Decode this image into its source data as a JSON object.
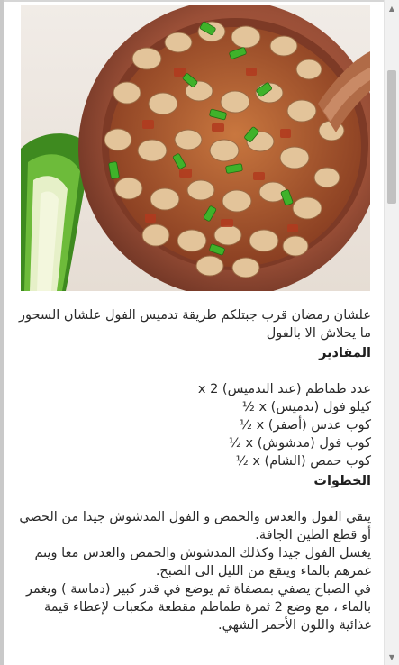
{
  "hero": {
    "icon": "foul-medames-dish-photo"
  },
  "article": {
    "intro": "علشان رمضان قرب جبتلكم طريقة تدميس الفول علشان السحور ما يحلاش الا بالفول",
    "ingredients_heading": "المقادير",
    "ingredients": [
      "عدد طماطم (عند التدميس) x 2",
      "كيلو فول (تدميس) x ½",
      "كوب عدس (أصفر) x ½",
      "كوب فول (مدشوش) x ½",
      "كوب حمص (الشام) x ½"
    ],
    "steps_heading": "الخطوات",
    "steps": [
      "ينقي الفول والعدس والحمص و الفول المدشوش جيدا من الحصي أو قطع الطين الجافة.",
      "يغسل الفول جيدا وكذلك المدشوش والحمص والعدس معا ويتم غمرهم بالماء ويتقع من الليل الى الصبح.",
      "في الصباح يصفي بمصفاة ثم يوضع في قدر كبير (دماسة ) ويغمر بالماء ، مع وضع 2 ثمرة طماطم مقطعة مكعبات لإعطاء قيمة غذائية واللون الأحمر الشهي."
    ]
  },
  "colors": {
    "text": "#2a2a2a",
    "background": "#ffffff",
    "scrollbar_thumb": "#c1c1c1"
  }
}
